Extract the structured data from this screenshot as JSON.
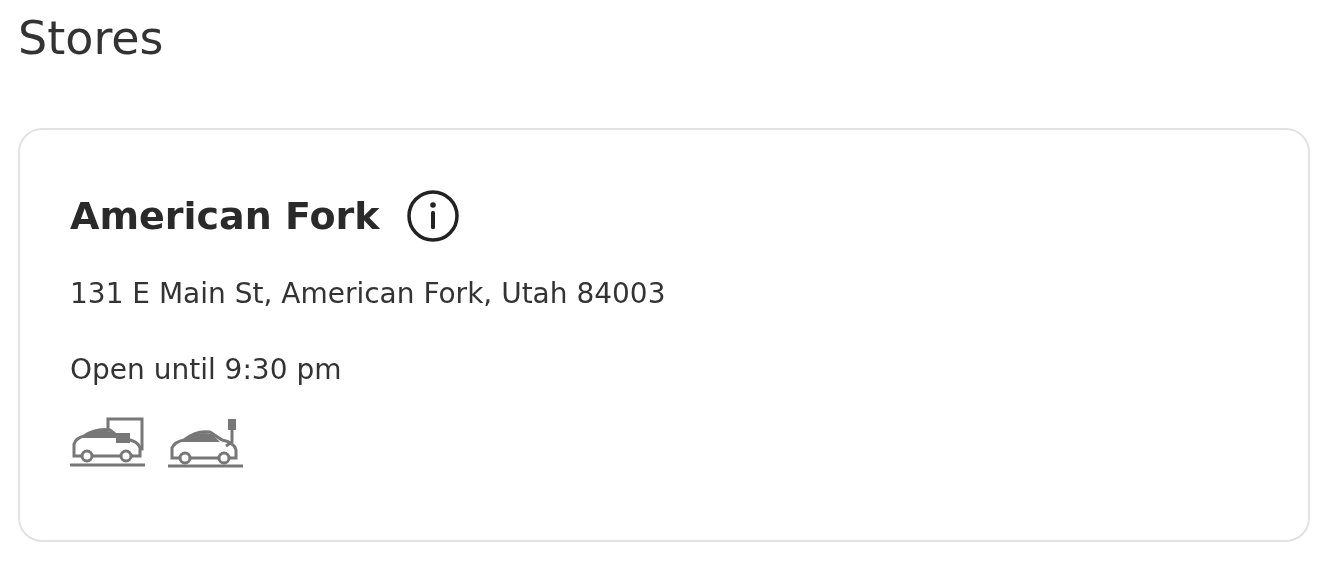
{
  "page_title": "Stores",
  "store": {
    "name": "American Fork",
    "address": "131 E Main St, American Fork, Utah 84003",
    "hours": "Open until 9:30 pm"
  }
}
